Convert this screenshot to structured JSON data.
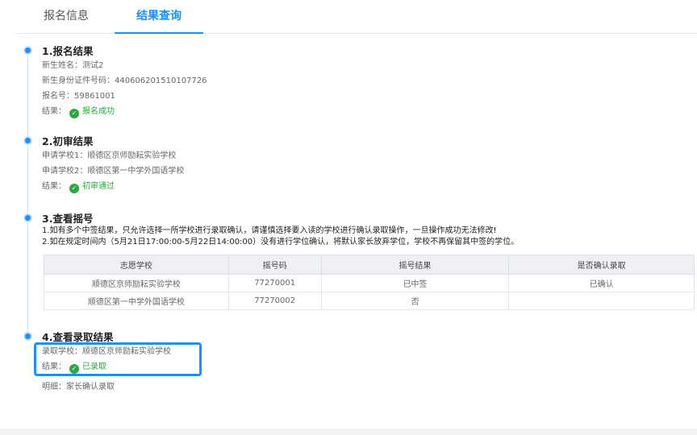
{
  "tabs": [
    {
      "label": "报名信息"
    },
    {
      "label": "结果查询"
    }
  ],
  "s1": {
    "title": "1.报名结果",
    "name_label": "新生姓名：",
    "name_value": "测试2",
    "id_label": "新生身份证件号码：",
    "id_value": "440606201510107726",
    "reg_label": "报名号：",
    "reg_value": "59861001",
    "result_label": "结果：",
    "result_value": "报名成功"
  },
  "s2": {
    "title": "2.初审结果",
    "school1_label": "申请学校1：",
    "school1_value": "顺德区京师励耘实验学校",
    "school2_label": "申请学校2：",
    "school2_value": "顺德区第一中学外国语学校",
    "result_label": "结果：",
    "result_value": "初审通过"
  },
  "s3": {
    "title": "3.查看摇号",
    "notice1": "1.如有多个中签结果，只允许选择一所学校进行录取确认，请谨慎选择要入读的学校进行确认录取操作，一旦操作成功无法修改!",
    "notice2": "2.如在规定时间内（5月21日17:00:00-5月22日14:00:00）没有进行学位确认，将默认家长放弃学位，学校不再保留其中签的学位。",
    "columns": [
      "志愿学校",
      "摇号码",
      "摇号结果",
      "是否确认录取"
    ],
    "rows": [
      {
        "school": "顺德区京师励耘实验学校",
        "code": "77270001",
        "result": "已中签",
        "confirm": "已确认"
      },
      {
        "school": "顺德区第一中学外国语学校",
        "code": "77270002",
        "result": "否",
        "confirm": ""
      }
    ]
  },
  "s4": {
    "title": "4.查看录取结果",
    "school_label": "录取学校：",
    "school_value": "顺德区京师励耘实验学校",
    "result_label": "结果：",
    "result_value": "已录取",
    "detail_label": "明细：",
    "detail_value": "家长确认录取"
  },
  "icons": {
    "check": "check-circle-icon",
    "dot": "timeline-dot"
  },
  "colors": {
    "accent": "#1890ff",
    "success": "#2aa83c",
    "danger": "#e03232"
  }
}
